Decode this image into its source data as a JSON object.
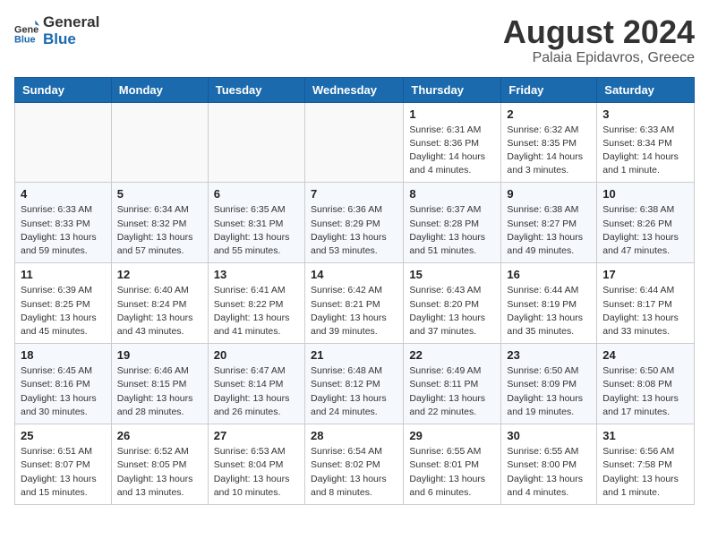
{
  "header": {
    "logo_general": "General",
    "logo_blue": "Blue",
    "month": "August 2024",
    "location": "Palaia Epidavros, Greece"
  },
  "days_of_week": [
    "Sunday",
    "Monday",
    "Tuesday",
    "Wednesday",
    "Thursday",
    "Friday",
    "Saturday"
  ],
  "weeks": [
    [
      {
        "day": "",
        "info": ""
      },
      {
        "day": "",
        "info": ""
      },
      {
        "day": "",
        "info": ""
      },
      {
        "day": "",
        "info": ""
      },
      {
        "day": "1",
        "info": "Sunrise: 6:31 AM\nSunset: 8:36 PM\nDaylight: 14 hours\nand 4 minutes."
      },
      {
        "day": "2",
        "info": "Sunrise: 6:32 AM\nSunset: 8:35 PM\nDaylight: 14 hours\nand 3 minutes."
      },
      {
        "day": "3",
        "info": "Sunrise: 6:33 AM\nSunset: 8:34 PM\nDaylight: 14 hours\nand 1 minute."
      }
    ],
    [
      {
        "day": "4",
        "info": "Sunrise: 6:33 AM\nSunset: 8:33 PM\nDaylight: 13 hours\nand 59 minutes."
      },
      {
        "day": "5",
        "info": "Sunrise: 6:34 AM\nSunset: 8:32 PM\nDaylight: 13 hours\nand 57 minutes."
      },
      {
        "day": "6",
        "info": "Sunrise: 6:35 AM\nSunset: 8:31 PM\nDaylight: 13 hours\nand 55 minutes."
      },
      {
        "day": "7",
        "info": "Sunrise: 6:36 AM\nSunset: 8:29 PM\nDaylight: 13 hours\nand 53 minutes."
      },
      {
        "day": "8",
        "info": "Sunrise: 6:37 AM\nSunset: 8:28 PM\nDaylight: 13 hours\nand 51 minutes."
      },
      {
        "day": "9",
        "info": "Sunrise: 6:38 AM\nSunset: 8:27 PM\nDaylight: 13 hours\nand 49 minutes."
      },
      {
        "day": "10",
        "info": "Sunrise: 6:38 AM\nSunset: 8:26 PM\nDaylight: 13 hours\nand 47 minutes."
      }
    ],
    [
      {
        "day": "11",
        "info": "Sunrise: 6:39 AM\nSunset: 8:25 PM\nDaylight: 13 hours\nand 45 minutes."
      },
      {
        "day": "12",
        "info": "Sunrise: 6:40 AM\nSunset: 8:24 PM\nDaylight: 13 hours\nand 43 minutes."
      },
      {
        "day": "13",
        "info": "Sunrise: 6:41 AM\nSunset: 8:22 PM\nDaylight: 13 hours\nand 41 minutes."
      },
      {
        "day": "14",
        "info": "Sunrise: 6:42 AM\nSunset: 8:21 PM\nDaylight: 13 hours\nand 39 minutes."
      },
      {
        "day": "15",
        "info": "Sunrise: 6:43 AM\nSunset: 8:20 PM\nDaylight: 13 hours\nand 37 minutes."
      },
      {
        "day": "16",
        "info": "Sunrise: 6:44 AM\nSunset: 8:19 PM\nDaylight: 13 hours\nand 35 minutes."
      },
      {
        "day": "17",
        "info": "Sunrise: 6:44 AM\nSunset: 8:17 PM\nDaylight: 13 hours\nand 33 minutes."
      }
    ],
    [
      {
        "day": "18",
        "info": "Sunrise: 6:45 AM\nSunset: 8:16 PM\nDaylight: 13 hours\nand 30 minutes."
      },
      {
        "day": "19",
        "info": "Sunrise: 6:46 AM\nSunset: 8:15 PM\nDaylight: 13 hours\nand 28 minutes."
      },
      {
        "day": "20",
        "info": "Sunrise: 6:47 AM\nSunset: 8:14 PM\nDaylight: 13 hours\nand 26 minutes."
      },
      {
        "day": "21",
        "info": "Sunrise: 6:48 AM\nSunset: 8:12 PM\nDaylight: 13 hours\nand 24 minutes."
      },
      {
        "day": "22",
        "info": "Sunrise: 6:49 AM\nSunset: 8:11 PM\nDaylight: 13 hours\nand 22 minutes."
      },
      {
        "day": "23",
        "info": "Sunrise: 6:50 AM\nSunset: 8:09 PM\nDaylight: 13 hours\nand 19 minutes."
      },
      {
        "day": "24",
        "info": "Sunrise: 6:50 AM\nSunset: 8:08 PM\nDaylight: 13 hours\nand 17 minutes."
      }
    ],
    [
      {
        "day": "25",
        "info": "Sunrise: 6:51 AM\nSunset: 8:07 PM\nDaylight: 13 hours\nand 15 minutes."
      },
      {
        "day": "26",
        "info": "Sunrise: 6:52 AM\nSunset: 8:05 PM\nDaylight: 13 hours\nand 13 minutes."
      },
      {
        "day": "27",
        "info": "Sunrise: 6:53 AM\nSunset: 8:04 PM\nDaylight: 13 hours\nand 10 minutes."
      },
      {
        "day": "28",
        "info": "Sunrise: 6:54 AM\nSunset: 8:02 PM\nDaylight: 13 hours\nand 8 minutes."
      },
      {
        "day": "29",
        "info": "Sunrise: 6:55 AM\nSunset: 8:01 PM\nDaylight: 13 hours\nand 6 minutes."
      },
      {
        "day": "30",
        "info": "Sunrise: 6:55 AM\nSunset: 8:00 PM\nDaylight: 13 hours\nand 4 minutes."
      },
      {
        "day": "31",
        "info": "Sunrise: 6:56 AM\nSunset: 7:58 PM\nDaylight: 13 hours\nand 1 minute."
      }
    ]
  ]
}
